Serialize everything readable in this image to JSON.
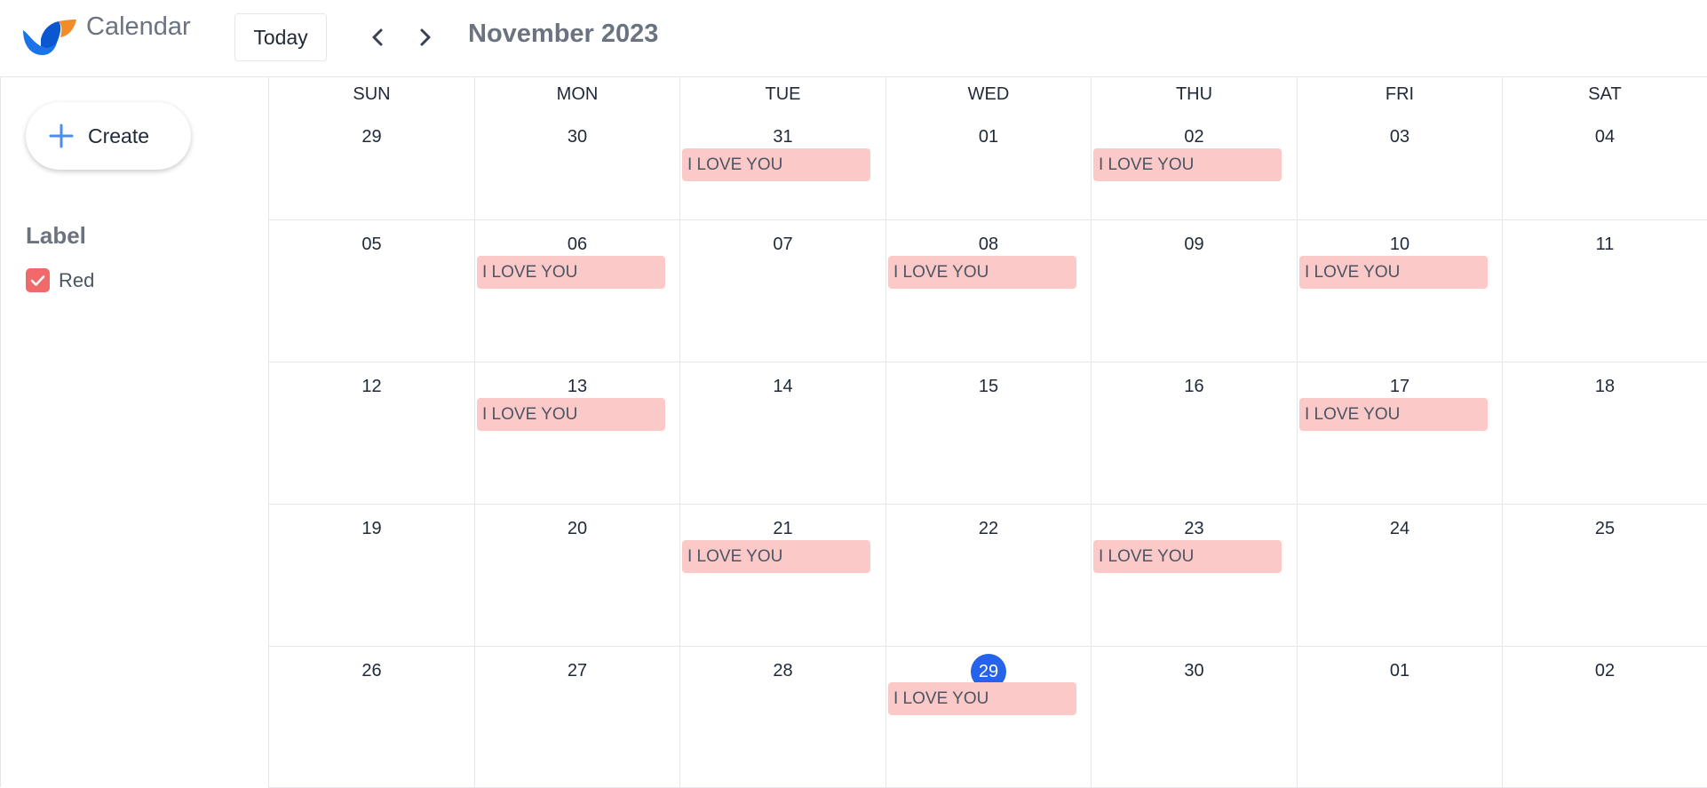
{
  "header": {
    "app_title": "Calendar",
    "today_label": "Today",
    "month_title": "November 2023",
    "brand_colors": {
      "blue": "#1a73e8",
      "orange": "#f28c28"
    }
  },
  "sidebar": {
    "create_label": "Create",
    "label_heading": "Label",
    "labels": [
      {
        "name": "Red",
        "checked": true,
        "color": "#f06a6a"
      }
    ]
  },
  "calendar": {
    "weekdays": [
      "SUN",
      "MON",
      "TUE",
      "WED",
      "THU",
      "FRI",
      "SAT"
    ],
    "weeks": [
      [
        {
          "day": "29",
          "events": []
        },
        {
          "day": "30",
          "events": []
        },
        {
          "day": "31",
          "events": [
            "I LOVE YOU"
          ]
        },
        {
          "day": "01",
          "events": []
        },
        {
          "day": "02",
          "events": [
            "I LOVE YOU"
          ]
        },
        {
          "day": "03",
          "events": []
        },
        {
          "day": "04",
          "events": []
        }
      ],
      [
        {
          "day": "05",
          "events": []
        },
        {
          "day": "06",
          "events": [
            "I LOVE YOU"
          ]
        },
        {
          "day": "07",
          "events": []
        },
        {
          "day": "08",
          "events": [
            "I LOVE YOU"
          ]
        },
        {
          "day": "09",
          "events": []
        },
        {
          "day": "10",
          "events": [
            "I LOVE YOU"
          ]
        },
        {
          "day": "11",
          "events": []
        }
      ],
      [
        {
          "day": "12",
          "events": []
        },
        {
          "day": "13",
          "events": [
            "I LOVE YOU"
          ]
        },
        {
          "day": "14",
          "events": []
        },
        {
          "day": "15",
          "events": []
        },
        {
          "day": "16",
          "events": []
        },
        {
          "day": "17",
          "events": [
            "I LOVE YOU"
          ]
        },
        {
          "day": "18",
          "events": []
        }
      ],
      [
        {
          "day": "19",
          "events": []
        },
        {
          "day": "20",
          "events": []
        },
        {
          "day": "21",
          "events": [
            "I LOVE YOU"
          ]
        },
        {
          "day": "22",
          "events": []
        },
        {
          "day": "23",
          "events": [
            "I LOVE YOU"
          ]
        },
        {
          "day": "24",
          "events": []
        },
        {
          "day": "25",
          "events": []
        }
      ],
      [
        {
          "day": "26",
          "events": []
        },
        {
          "day": "27",
          "events": []
        },
        {
          "day": "28",
          "events": []
        },
        {
          "day": "29",
          "events": [
            "I LOVE YOU"
          ],
          "today": true
        },
        {
          "day": "30",
          "events": []
        },
        {
          "day": "01",
          "events": []
        },
        {
          "day": "02",
          "events": []
        }
      ]
    ],
    "event_color": "#fcc9c9",
    "today_color": "#2563eb"
  }
}
